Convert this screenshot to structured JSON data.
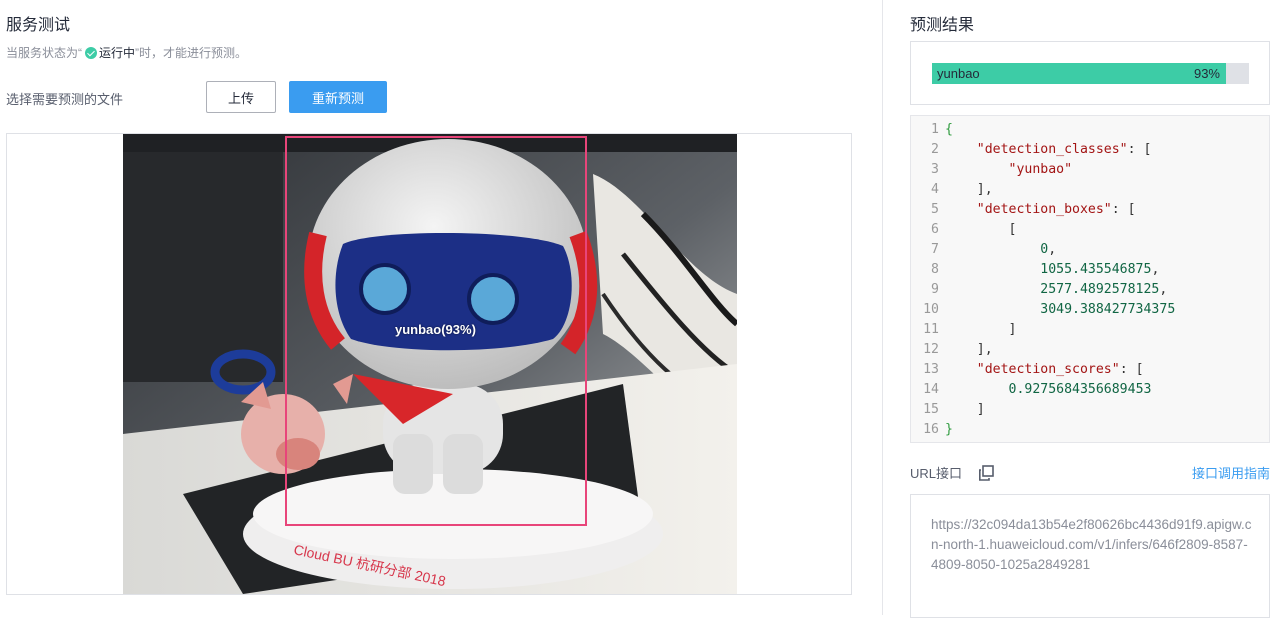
{
  "left": {
    "title": "服务测试",
    "hint_prefix": "当服务状态为“",
    "hint_status": "运行中",
    "hint_suffix": "”时，才能进行预测。",
    "file_label": "选择需要预测的文件",
    "upload_button": "上传",
    "repredict_button": "重新预测",
    "detection_label": "yunbao(93%)"
  },
  "right": {
    "title": "预测结果",
    "result": {
      "name": "yunbao",
      "percent_text": "93%",
      "score": 0.9275684356689453
    },
    "code_lines": [
      {
        "n": "1",
        "parts": [
          {
            "t": "{",
            "c": "brace"
          }
        ]
      },
      {
        "n": "2",
        "parts": [
          {
            "t": "    ",
            "c": "punc"
          },
          {
            "t": "\"detection_classes\"",
            "c": "key"
          },
          {
            "t": ": [",
            "c": "punc"
          }
        ]
      },
      {
        "n": "3",
        "parts": [
          {
            "t": "        ",
            "c": "punc"
          },
          {
            "t": "\"yunbao\"",
            "c": "str"
          }
        ]
      },
      {
        "n": "4",
        "parts": [
          {
            "t": "    ],",
            "c": "punc"
          }
        ]
      },
      {
        "n": "5",
        "parts": [
          {
            "t": "    ",
            "c": "punc"
          },
          {
            "t": "\"detection_boxes\"",
            "c": "key"
          },
          {
            "t": ": [",
            "c": "punc"
          }
        ]
      },
      {
        "n": "6",
        "parts": [
          {
            "t": "        [",
            "c": "punc"
          }
        ]
      },
      {
        "n": "7",
        "parts": [
          {
            "t": "            ",
            "c": "punc"
          },
          {
            "t": "0",
            "c": "num"
          },
          {
            "t": ",",
            "c": "punc"
          }
        ]
      },
      {
        "n": "8",
        "parts": [
          {
            "t": "            ",
            "c": "punc"
          },
          {
            "t": "1055.435546875",
            "c": "num"
          },
          {
            "t": ",",
            "c": "punc"
          }
        ]
      },
      {
        "n": "9",
        "parts": [
          {
            "t": "            ",
            "c": "punc"
          },
          {
            "t": "2577.4892578125",
            "c": "num"
          },
          {
            "t": ",",
            "c": "punc"
          }
        ]
      },
      {
        "n": "10",
        "parts": [
          {
            "t": "            ",
            "c": "punc"
          },
          {
            "t": "3049.388427734375",
            "c": "num"
          }
        ]
      },
      {
        "n": "11",
        "parts": [
          {
            "t": "        ]",
            "c": "punc"
          }
        ]
      },
      {
        "n": "12",
        "parts": [
          {
            "t": "    ],",
            "c": "punc"
          }
        ]
      },
      {
        "n": "13",
        "parts": [
          {
            "t": "    ",
            "c": "punc"
          },
          {
            "t": "\"detection_scores\"",
            "c": "key"
          },
          {
            "t": ": [",
            "c": "punc"
          }
        ]
      },
      {
        "n": "14",
        "parts": [
          {
            "t": "        ",
            "c": "punc"
          },
          {
            "t": "0.9275684356689453",
            "c": "num"
          }
        ]
      },
      {
        "n": "15",
        "parts": [
          {
            "t": "    ]",
            "c": "punc"
          }
        ]
      },
      {
        "n": "16",
        "parts": [
          {
            "t": "}",
            "c": "brace"
          }
        ]
      }
    ],
    "url_label": "URL接口",
    "api_guide_link": "接口调用指南",
    "url_value": "https://32c094da13b54e2f80626bc4436d91f9.apigw.cn-north-1.huaweicloud.com/v1/infers/646f2809-8587-4809-8050-1025a2849281"
  },
  "icons": {
    "status": "check-circle-icon",
    "copy": "copy-icon"
  },
  "colors": {
    "primary": "#3a9cf0",
    "success": "#3dcca6",
    "detection_box": "#e8457a"
  }
}
